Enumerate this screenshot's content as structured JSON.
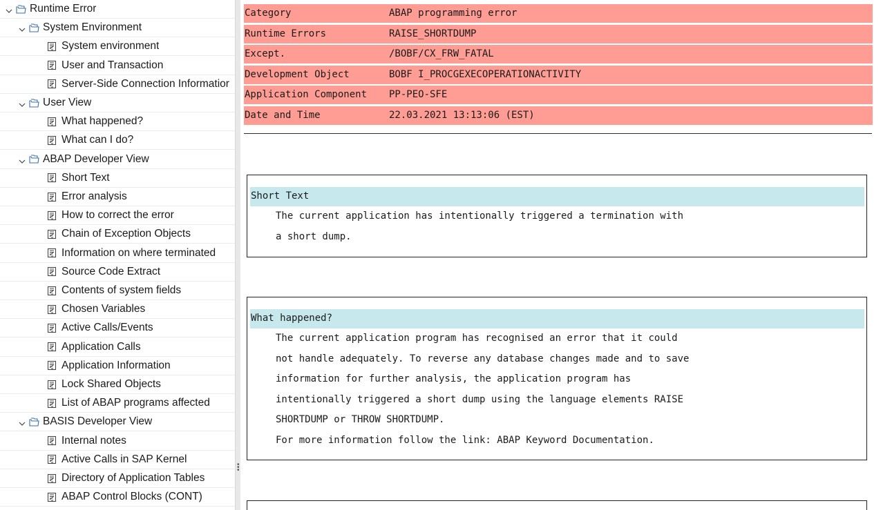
{
  "tree": [
    {
      "label": "Runtime Error",
      "level": 0,
      "type": "folder"
    },
    {
      "label": "System Environment",
      "level": 1,
      "type": "folder"
    },
    {
      "label": "System environment",
      "level": 2,
      "type": "doc"
    },
    {
      "label": "User and Transaction",
      "level": 2,
      "type": "doc"
    },
    {
      "label": "Server-Side Connection Informatior",
      "level": 2,
      "type": "doc"
    },
    {
      "label": "User View",
      "level": 1,
      "type": "folder"
    },
    {
      "label": "What happened?",
      "level": 2,
      "type": "doc"
    },
    {
      "label": "What can I do?",
      "level": 2,
      "type": "doc"
    },
    {
      "label": "ABAP Developer View",
      "level": 1,
      "type": "folder"
    },
    {
      "label": "Short Text",
      "level": 2,
      "type": "doc"
    },
    {
      "label": "Error analysis",
      "level": 2,
      "type": "doc"
    },
    {
      "label": "How to correct the error",
      "level": 2,
      "type": "doc"
    },
    {
      "label": "Chain of Exception Objects",
      "level": 2,
      "type": "doc"
    },
    {
      "label": "Information on where terminated",
      "level": 2,
      "type": "doc"
    },
    {
      "label": "Source Code Extract",
      "level": 2,
      "type": "doc"
    },
    {
      "label": "Contents of system fields",
      "level": 2,
      "type": "doc"
    },
    {
      "label": "Chosen Variables",
      "level": 2,
      "type": "doc"
    },
    {
      "label": "Active Calls/Events",
      "level": 2,
      "type": "doc"
    },
    {
      "label": "Application Calls",
      "level": 2,
      "type": "doc"
    },
    {
      "label": "Application Information",
      "level": 2,
      "type": "doc"
    },
    {
      "label": "Lock Shared Objects",
      "level": 2,
      "type": "doc"
    },
    {
      "label": "List of ABAP programs affected",
      "level": 2,
      "type": "doc"
    },
    {
      "label": "BASIS Developer View",
      "level": 1,
      "type": "folder"
    },
    {
      "label": "Internal notes",
      "level": 2,
      "type": "doc"
    },
    {
      "label": "Active Calls in SAP Kernel",
      "level": 2,
      "type": "doc"
    },
    {
      "label": "Directory of Application Tables",
      "level": 2,
      "type": "doc"
    },
    {
      "label": "ABAP Control Blocks (CONT)",
      "level": 2,
      "type": "doc"
    }
  ],
  "header_rows": [
    {
      "key": "Category",
      "value": "ABAP programming error"
    },
    {
      "key": "Runtime Errors",
      "value": "RAISE_SHORTDUMP"
    },
    {
      "key": "Except.",
      "value": "/BOBF/CX_FRW_FATAL"
    },
    {
      "key": "Development Object",
      "value": "BOBF I_PROCGEXECOPERATIONACTIVITY"
    },
    {
      "key": "Application Component",
      "value": "PP-PEO-SFE"
    },
    {
      "key": "Date and Time",
      "value": "22.03.2021 13:13:06 (EST)"
    }
  ],
  "sections": [
    {
      "title": "Short Text",
      "lines": [
        "The current application has intentionally triggered a termination with",
        "a short dump."
      ]
    },
    {
      "title": "What happened?",
      "lines": [
        "The current application program has recognised an error that it could",
        "not handle adequately. To reverse any database changes made and to save",
        "information for further analysis, the application program has",
        "intentionally triggered a short dump using the language elements RAISE",
        "SHORTDUMP or THROW SHORTDUMP.",
        "For more information follow the link: ABAP Keyword Documentation."
      ]
    }
  ],
  "colors": {
    "header_bg": "#ff9d94",
    "section_title_bg": "#c7e9ee",
    "folder_icon": "#3b6ea5",
    "doc_icon": "#444444"
  },
  "icons": {
    "expand": "chevron-down-icon",
    "folder": "folder-open-icon",
    "doc": "document-icon"
  }
}
